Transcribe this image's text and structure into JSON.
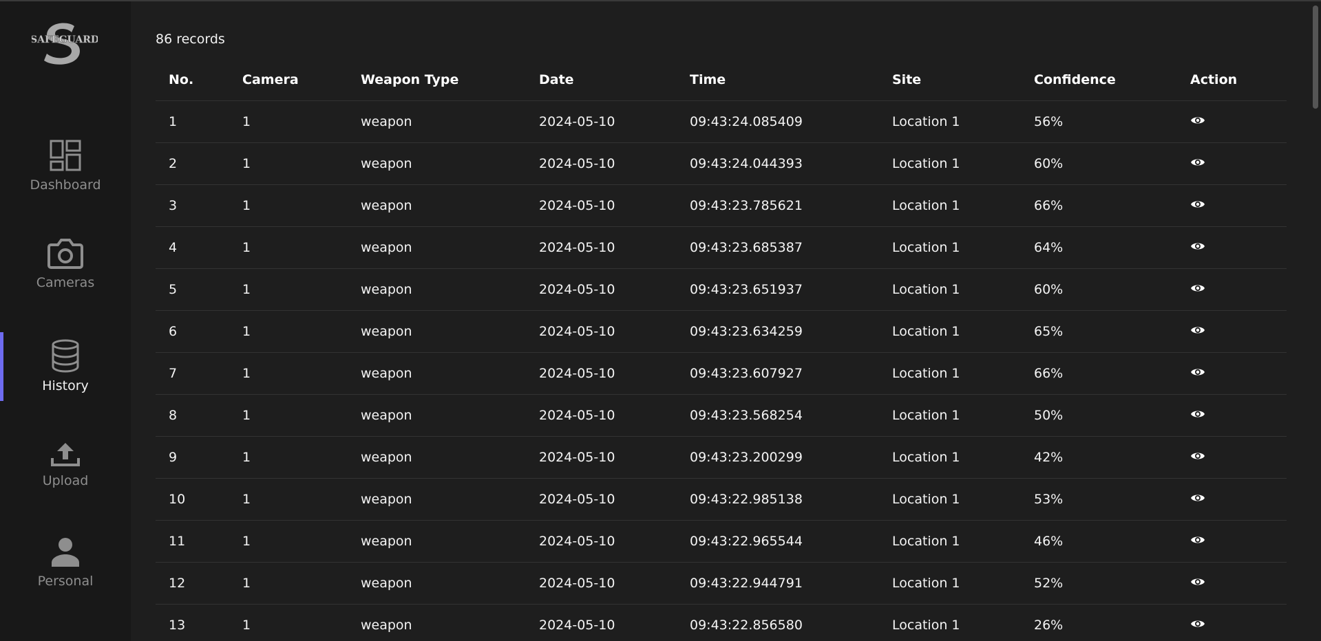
{
  "brand": {
    "name": "SAFEGUARD"
  },
  "nav": [
    {
      "label": "Dashboard",
      "icon": "dashboard-icon"
    },
    {
      "label": "Cameras",
      "icon": "camera-icon"
    },
    {
      "label": "History",
      "icon": "database-icon",
      "active": true
    },
    {
      "label": "Upload",
      "icon": "upload-icon"
    },
    {
      "label": "Personal",
      "icon": "person-icon"
    }
  ],
  "records_label": "86 records",
  "table": {
    "headers": [
      "No.",
      "Camera",
      "Weapon Type",
      "Date",
      "Time",
      "Site",
      "Confidence",
      "Action"
    ],
    "rows": [
      [
        "1",
        "1",
        "weapon",
        "2024-05-10",
        "09:43:24.085409",
        "Location 1",
        "56%"
      ],
      [
        "2",
        "1",
        "weapon",
        "2024-05-10",
        "09:43:24.044393",
        "Location 1",
        "60%"
      ],
      [
        "3",
        "1",
        "weapon",
        "2024-05-10",
        "09:43:23.785621",
        "Location 1",
        "66%"
      ],
      [
        "4",
        "1",
        "weapon",
        "2024-05-10",
        "09:43:23.685387",
        "Location 1",
        "64%"
      ],
      [
        "5",
        "1",
        "weapon",
        "2024-05-10",
        "09:43:23.651937",
        "Location 1",
        "60%"
      ],
      [
        "6",
        "1",
        "weapon",
        "2024-05-10",
        "09:43:23.634259",
        "Location 1",
        "65%"
      ],
      [
        "7",
        "1",
        "weapon",
        "2024-05-10",
        "09:43:23.607927",
        "Location 1",
        "66%"
      ],
      [
        "8",
        "1",
        "weapon",
        "2024-05-10",
        "09:43:23.568254",
        "Location 1",
        "50%"
      ],
      [
        "9",
        "1",
        "weapon",
        "2024-05-10",
        "09:43:23.200299",
        "Location 1",
        "42%"
      ],
      [
        "10",
        "1",
        "weapon",
        "2024-05-10",
        "09:43:22.985138",
        "Location 1",
        "53%"
      ],
      [
        "11",
        "1",
        "weapon",
        "2024-05-10",
        "09:43:22.965544",
        "Location 1",
        "46%"
      ],
      [
        "12",
        "1",
        "weapon",
        "2024-05-10",
        "09:43:22.944791",
        "Location 1",
        "52%"
      ],
      [
        "13",
        "1",
        "weapon",
        "2024-05-10",
        "09:43:22.856580",
        "Location 1",
        "26%"
      ]
    ],
    "action_icon": "eye-icon"
  },
  "colors": {
    "background": "#1e1e1e",
    "sidebar": "#181818",
    "accent": "#6e6bf0",
    "muted_text": "#8e8e8e"
  }
}
